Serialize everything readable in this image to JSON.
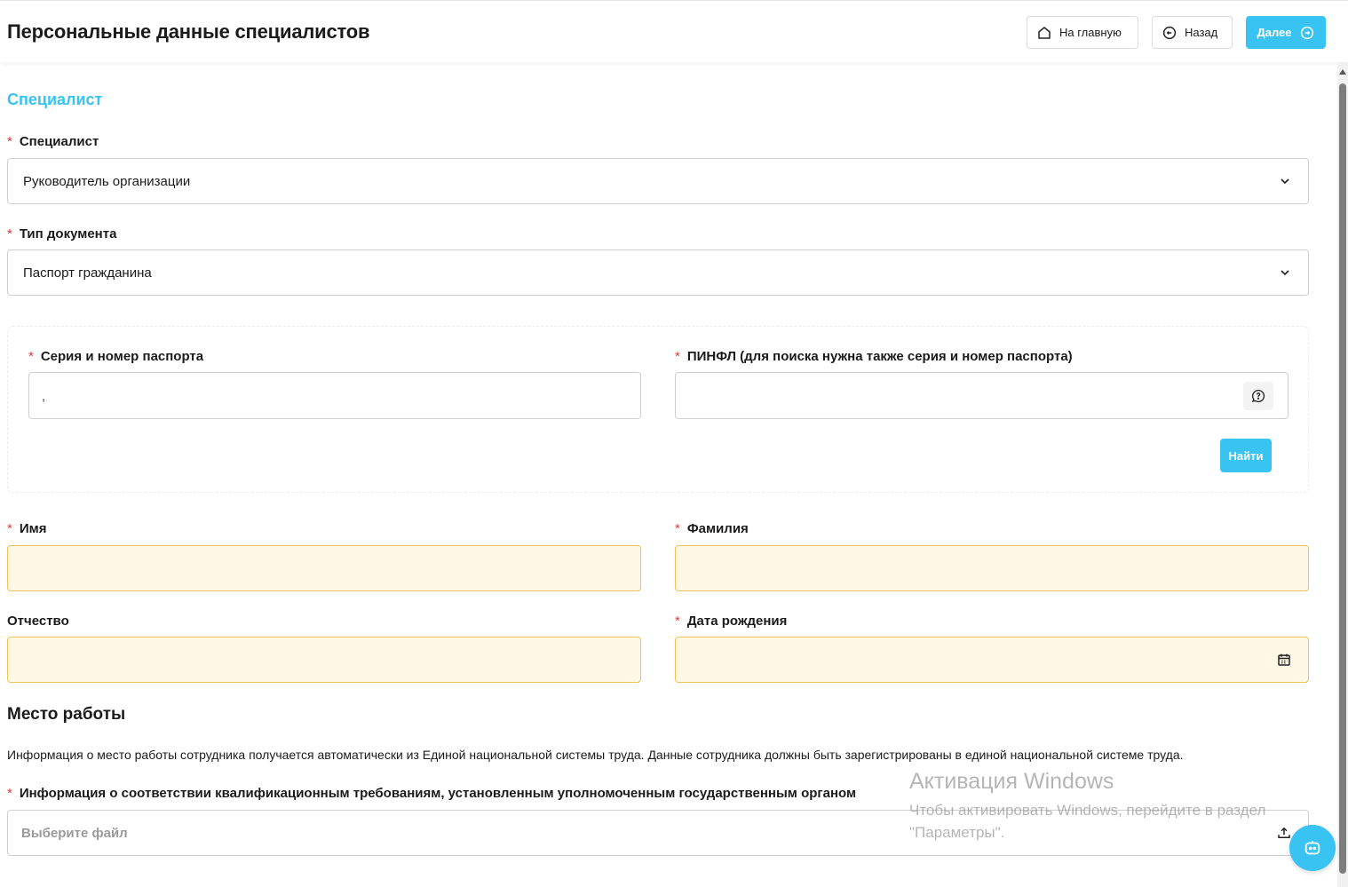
{
  "header": {
    "title": "Персональные данные специалистов",
    "home_label": "На главную",
    "back_label": "Назад",
    "next_label": "Далее"
  },
  "section": {
    "title": "Специалист"
  },
  "form": {
    "specialist": {
      "label": "Специалист",
      "value": "Руководитель организации"
    },
    "doc_type": {
      "label": "Тип документа",
      "value": "Паспорт гражданина"
    },
    "passport": {
      "label": "Серия и номер паспорта",
      "value": ","
    },
    "pinfl": {
      "label": "ПИНФЛ (для поиска нужна также серия и номер паспорта)",
      "value": ""
    },
    "find_label": "Найти",
    "first_name": {
      "label": "Имя",
      "value": ""
    },
    "last_name": {
      "label": "Фамилия",
      "value": ""
    },
    "patronymic": {
      "label": "Отчество",
      "value": ""
    },
    "birth_date": {
      "label": "Дата рождения",
      "value": ""
    }
  },
  "workplace": {
    "title": "Место работы",
    "info": "Информация о место работы сотрудника получается автоматически из Единой национальной системы труда. Данные сотрудника должны быть зарегистрированы в единой национальной системе труда.",
    "qualification_label": "Информация о соответствии квалификационным требованиям, установленным уполномоченным государственным органом",
    "file_placeholder": "Выберите файл"
  },
  "watermark": {
    "title": "Активация Windows",
    "line1": "Чтобы активировать Windows, перейдите в раздел",
    "line2": "\"Параметры\"."
  },
  "colors": {
    "accent": "#38c3f2",
    "required": "#e53935",
    "highlight_bg": "#fff8e6",
    "highlight_border": "#f1c25a"
  },
  "icons": [
    "home-icon",
    "back-circle-icon",
    "forward-circle-icon",
    "chevron-down-icon",
    "question-chat-icon",
    "calendar-icon",
    "upload-icon",
    "chat-bot-icon"
  ]
}
